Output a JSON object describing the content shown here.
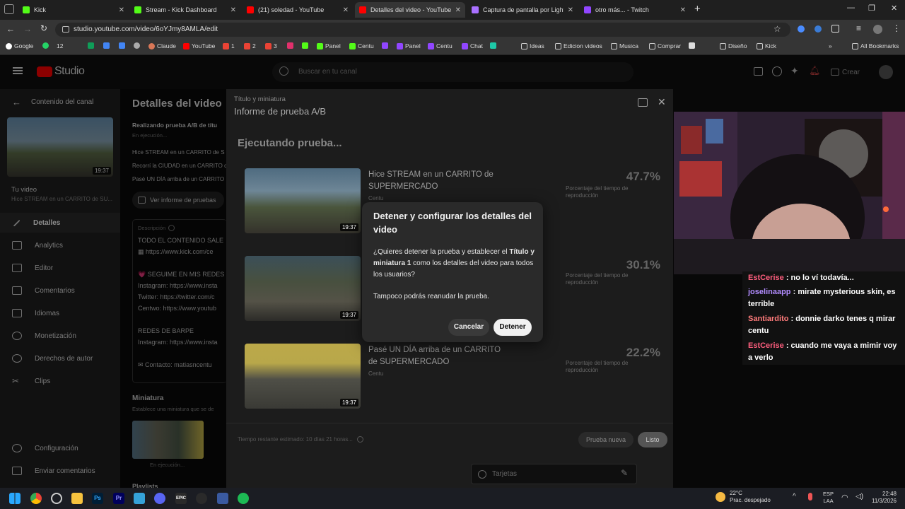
{
  "browser": {
    "tabs": [
      {
        "title": "Kick",
        "color": "#53fc18"
      },
      {
        "title": "Stream - Kick Dashboard",
        "color": "#53fc18"
      },
      {
        "title": "(21) soledad - YouTube",
        "color": "#ff0000"
      },
      {
        "title": "Detalles del video - YouTube St",
        "color": "#ff0000",
        "active": true
      },
      {
        "title": "Captura de pantalla por Lightsh",
        "color": "#a970ff"
      },
      {
        "title": "otro más... - Twitch",
        "color": "#9146ff"
      }
    ],
    "new_tab": "+",
    "url": "studio.youtube.com/video/6oYJmy8AMLA/edit",
    "bookmarks": [
      "Google",
      "12",
      "",
      "",
      "",
      "",
      "Claude",
      "YouTube",
      "1",
      "2",
      "3",
      "",
      "",
      "Panel",
      "Centu",
      "",
      "Panel",
      "Centu",
      "Chat",
      "",
      "Ideas",
      "Edicion videos",
      "Musica",
      "Comprar",
      "",
      "Diseño",
      "Kick"
    ],
    "all_bookmarks": "All Bookmarks"
  },
  "studio": {
    "logo": "Studio",
    "search_placeholder": "Buscar en tu canal",
    "create": "Crear"
  },
  "sidebar": {
    "back": "Contenido del canal",
    "video_label": "Tu video",
    "video_title": "Hice STREAM en un CARRITO de SU...",
    "duration": "19:37",
    "items": [
      "Detalles",
      "Analytics",
      "Editor",
      "Comentarios",
      "Idiomas",
      "Monetización",
      "Derechos de autor",
      "Clips"
    ],
    "bottom": [
      "Configuración",
      "Enviar comentarios"
    ]
  },
  "details": {
    "heading": "Detalles del video",
    "ab_title": "Realizando prueba A/B de títu",
    "ab_status": "En ejecución...",
    "titles": [
      "Hice STREAM en un CARRITO de S",
      "Recorrí la CIUDAD en un CARRITO d",
      "Pasé UN DÍA arriba de un CARRITO"
    ],
    "report_link": "Ver informe de pruebas",
    "desc_label": "Descripción",
    "desc_lines": [
      "TODO EL CONTENIDO SALE",
      "https://www.kick.com/ce",
      "",
      "SEGUIME EN MIS REDES",
      "Instagram: https://www.insta",
      "Twitter: https://twitter.com/c",
      "Centwo: https://www.youtub",
      "",
      "REDES DE BARPE",
      "Instagram: https://www.insta",
      "",
      "Contacto: matiasncentu"
    ],
    "thumb_label": "Miniatura",
    "thumb_desc": "Establece una miniatura que se de",
    "thumb_status": "En ejecución...",
    "playlist": "Playlists"
  },
  "ab_report": {
    "breadcrumb": "Título y miniatura",
    "title": "Informe de prueba A/B",
    "running": "Ejecutando prueba...",
    "metric_label": "Porcentaje del tiempo de reproducción",
    "variants": [
      {
        "title": "Hice STREAM en un CARRITO de SUPERMERCADO",
        "channel": "Centu",
        "pct": "47.7%",
        "duration": "19:37"
      },
      {
        "title": "",
        "channel": "",
        "pct": "30.1%",
        "duration": "19:37"
      },
      {
        "title": "Pasé UN DÍA arriba de un CARRITO de SUPERMERCADO",
        "channel": "Centu",
        "pct": "22.2%",
        "duration": "19:37"
      }
    ],
    "remaining": "Tiempo restante estimado: 10 días 21 horas...",
    "new_test": "Prueba nueva",
    "done": "Listo",
    "cards": "Tarjetas"
  },
  "dialog": {
    "title": "Detener y configurar los detalles del video",
    "body_1": "¿Quieres detener la prueba y establecer el",
    "body_bold": "Título y miniatura 1",
    "body_2": "como los detalles del video para todos los usuarios?",
    "body_3": "Tampoco podrás reanudar la prueba.",
    "cancel": "Cancelar",
    "stop": "Detener"
  },
  "chat": [
    {
      "user": "EstCerise",
      "color": "#ff5e7e",
      "msg": "no lo ví todavía..."
    },
    {
      "user": "joselinaapp",
      "color": "#b28cff",
      "msg": "mirate mysterious skin, es terrible"
    },
    {
      "user": "Santiardito",
      "color": "#ff7b7b",
      "msg": "donnie darko tenes q mirar centu"
    },
    {
      "user": "EstCerise",
      "color": "#ff5e7e",
      "msg": "cuando me vaya a mimir voy a verlo"
    }
  ],
  "taskbar": {
    "weather_temp": "22°C",
    "weather_desc": "Prac. despejado",
    "lang1": "ESP",
    "lang2": "LAA",
    "time": "22:48",
    "date": "11/3/2026"
  }
}
